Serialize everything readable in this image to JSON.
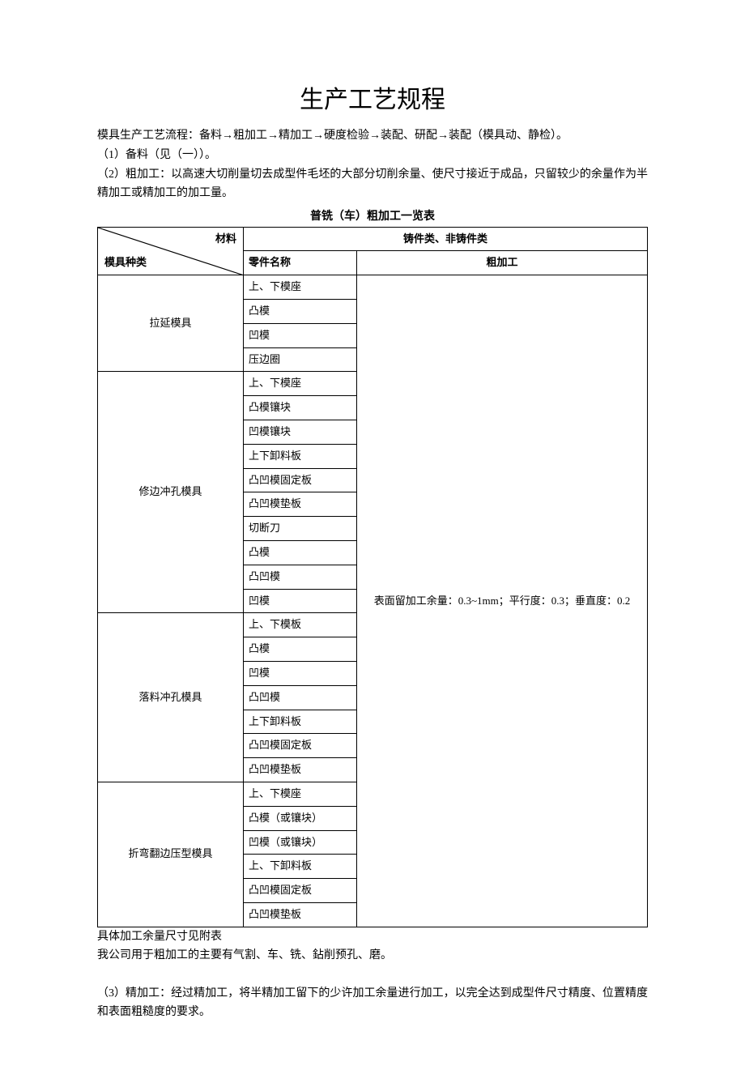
{
  "title": "生产工艺规程",
  "paragraphs": {
    "p1": "模具生产工艺流程：备料→粗加工→精加工→硬度检验→装配、研配→装配（模具动、静检）。",
    "p2": "（1）备料（见（一））。",
    "p3": "（2）粗加工：以高速大切削量切去成型件毛坯的大部分切削余量、使尺寸接近于成品，只留较少的余量作为半精加工或精加工的加工量。",
    "p4": "具体加工余量尺寸见附表",
    "p5": "我公司用于粗加工的主要有气割、车、铣、鉆削预孔、磨。",
    "p6": "（3）精加工：经过精加工，将半精加工留下的少许加工余量进行加工，以完全达到成型件尺寸精度、位置精度和表面粗糙度的要求。"
  },
  "table_caption": "普铣（车）粗加工一览表",
  "diag": {
    "top": "材料",
    "bottom": "模具种类"
  },
  "header": {
    "material_group": "铸件类、非铸件类",
    "part_name": "零件名称",
    "rough": "粗加工"
  },
  "machining_spec": "表面留加工余量：0.3~1mm；平行度：0.3；垂直度：0.2",
  "groups": [
    {
      "name": "拉延模具",
      "parts": [
        "上、下模座",
        "凸模",
        "凹模",
        "压边圈"
      ]
    },
    {
      "name": "修边冲孔模具",
      "parts": [
        "上、下模座",
        "凸模镶块",
        "凹模镶块",
        "上下卸料板",
        "凸凹模固定板",
        "凸凹模垫板",
        "切断刀",
        "凸模",
        "凸凹模",
        "凹模"
      ]
    },
    {
      "name": "落料冲孔模具",
      "parts": [
        "上、下模板",
        "凸模",
        "凹模",
        "凸凹模",
        "上下卸料板",
        "凸凹模固定板",
        "凸凹模垫板"
      ]
    },
    {
      "name": "折弯翻边压型模具",
      "parts": [
        "上、下模座",
        "凸模（或镶块）",
        "凹模（或镶块）",
        "上、下卸料板",
        "凸凹模固定板",
        "凸凹模垫板"
      ]
    }
  ]
}
